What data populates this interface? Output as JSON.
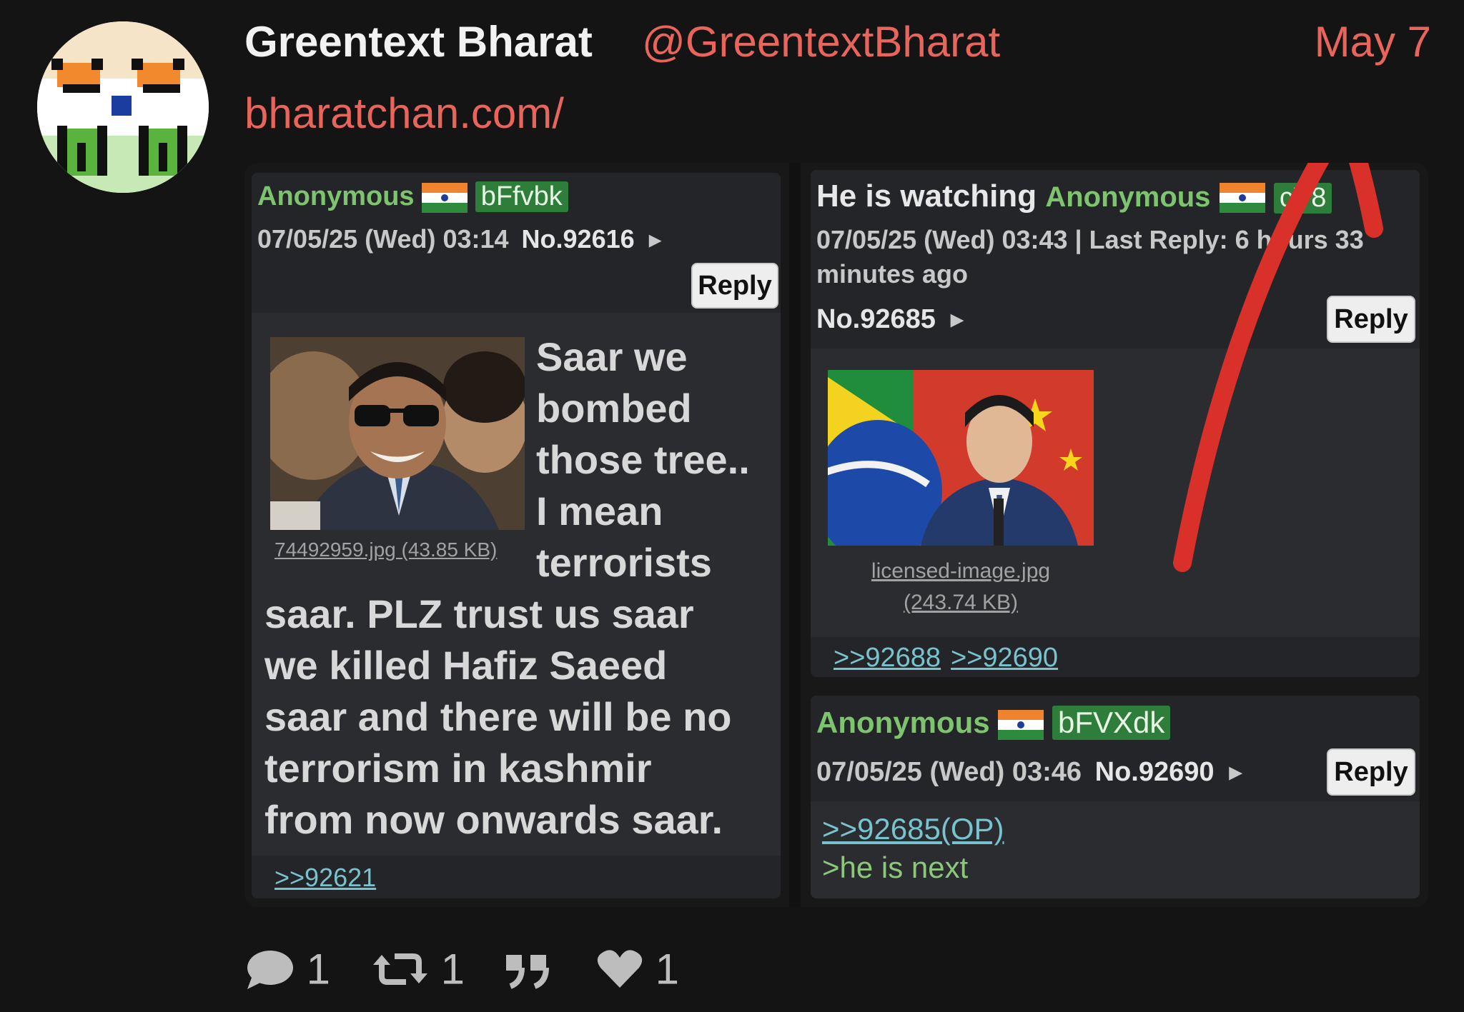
{
  "header": {
    "name": "Greentext Bharat",
    "handle": "@GreentextBharat",
    "date": "May 7",
    "link": "bharatchan.com/"
  },
  "posts": {
    "op1": {
      "name": "Anonymous",
      "id": "bFfvbk",
      "datetime": "07/05/25 (Wed) 03:14",
      "number": "No.92616",
      "reply_label": "Reply",
      "file": "74492959.jpg (43.85 KB)",
      "text_lines": [
        "Saar we",
        "bombed",
        "those tree..",
        "I mean",
        "terrorists"
      ],
      "text_wide_lines": [
        "saar. PLZ trust us saar",
        "we killed Hafiz Saeed",
        "saar and there will be no",
        "terrorism in kashmir",
        "from now onwards saar."
      ],
      "backlink": ">>92621"
    },
    "op2": {
      "subject": "He is watching",
      "name": "Anonymous",
      "id": "cY8",
      "datetime_line": "07/05/25 (Wed) 03:43 | Last Reply: 6 hours 33",
      "datetime_line2": "minutes ago",
      "number": "No.92685",
      "reply_label": "Reply",
      "file_name": "licensed-image.jpg",
      "file_size": "(243.74 KB)",
      "backlinks": [
        ">>92688",
        ">>92690"
      ]
    },
    "reply": {
      "name": "Anonymous",
      "id": "bFVXdk",
      "datetime": "07/05/25 (Wed) 03:46",
      "number": "No.92690",
      "reply_label": "Reply",
      "quote": ">>92685(OP)",
      "greentext": ">he is next"
    }
  },
  "footer": {
    "comments": "1",
    "retweets": "1",
    "likes": "1"
  },
  "colors": {
    "accent": "#e8655b",
    "annotation_arrow": "#d9302a",
    "greentext": "#8dc77b",
    "link": "#79c3cf"
  }
}
